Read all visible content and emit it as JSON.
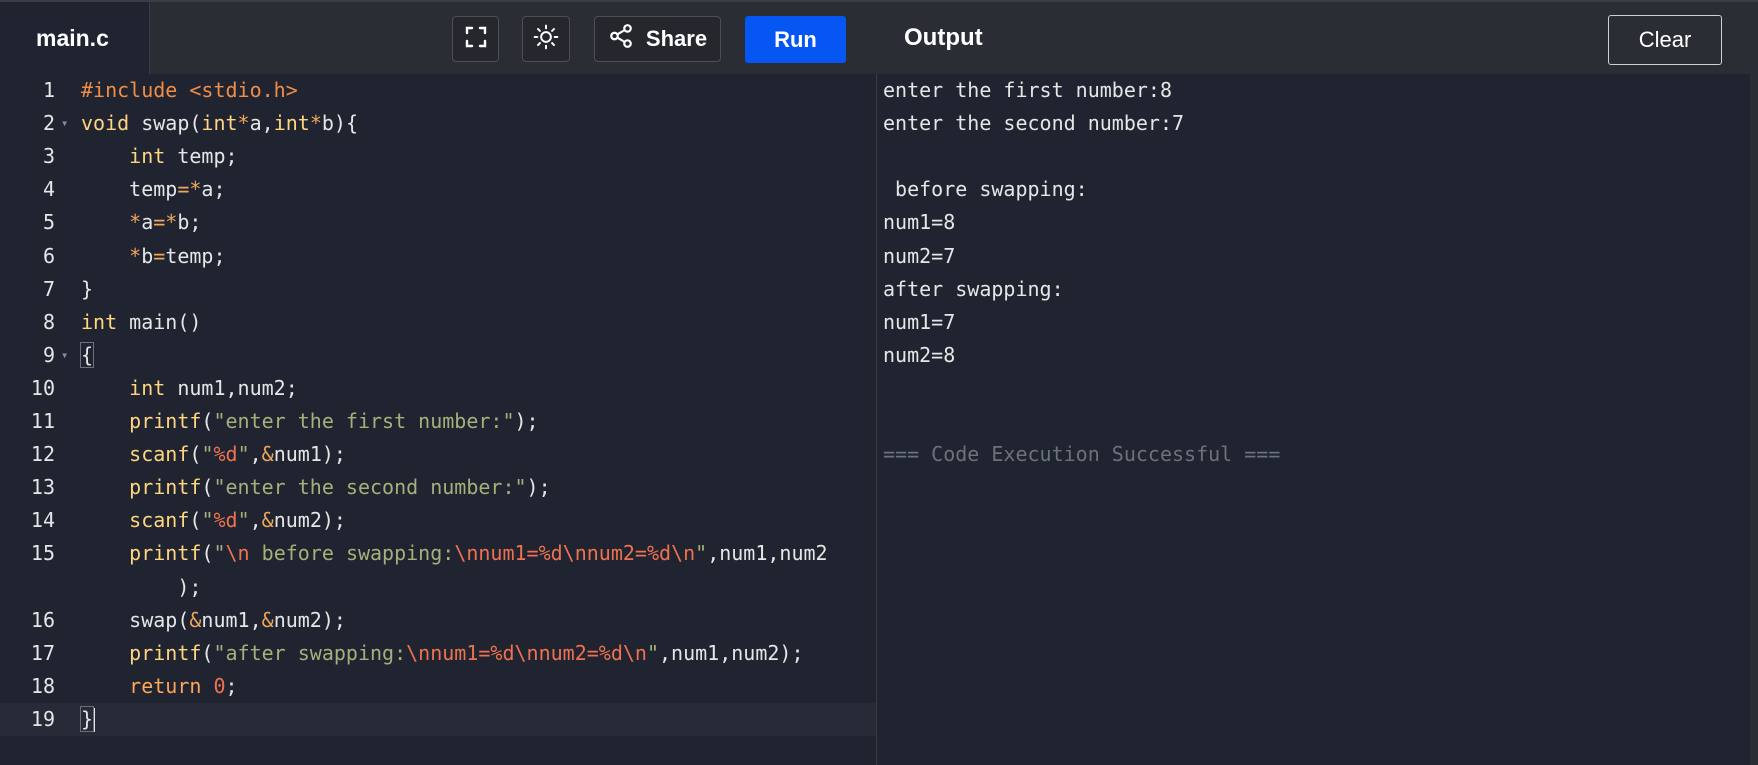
{
  "header": {
    "file_tab": "main.c",
    "share_label": "Share",
    "run_label": "Run",
    "output_title": "Output",
    "clear_label": "Clear"
  },
  "icons": {
    "fullscreen": "fullscreen-icon",
    "theme": "sun-icon",
    "share": "share-icon"
  },
  "colors": {
    "run_button": "#0556f3",
    "background": "#1f2430",
    "toolbar": "#2a2d34"
  },
  "editor": {
    "lines": [
      {
        "num": "1",
        "parts": [
          [
            "pre",
            "#include <stdio.h>"
          ]
        ]
      },
      {
        "num": "2",
        "fold": true,
        "parts": [
          [
            "kw",
            "void"
          ],
          [
            "",
            " swap("
          ],
          [
            "kw",
            "int"
          ],
          [
            "op",
            "*"
          ],
          [
            "",
            "a,"
          ],
          [
            "kw",
            "int"
          ],
          [
            "op",
            "*"
          ],
          [
            "",
            "b){"
          ]
        ]
      },
      {
        "num": "3",
        "parts": [
          [
            "",
            "    "
          ],
          [
            "kw",
            "int"
          ],
          [
            "",
            " temp;"
          ]
        ]
      },
      {
        "num": "4",
        "parts": [
          [
            "",
            "    temp"
          ],
          [
            "op",
            "=*"
          ],
          [
            "",
            "a;"
          ]
        ]
      },
      {
        "num": "5",
        "parts": [
          [
            "",
            "    "
          ],
          [
            "op",
            "*"
          ],
          [
            "",
            "a"
          ],
          [
            "op",
            "=*"
          ],
          [
            "",
            "b;"
          ]
        ]
      },
      {
        "num": "6",
        "parts": [
          [
            "",
            "    "
          ],
          [
            "op",
            "*"
          ],
          [
            "",
            "b"
          ],
          [
            "op",
            "="
          ],
          [
            "",
            "temp;"
          ]
        ]
      },
      {
        "num": "7",
        "parts": [
          [
            "",
            "}"
          ]
        ]
      },
      {
        "num": "8",
        "parts": [
          [
            "kw",
            "int"
          ],
          [
            "",
            " main()"
          ]
        ]
      },
      {
        "num": "9",
        "fold": true,
        "parts": [
          [
            "brace",
            "{"
          ]
        ]
      },
      {
        "num": "10",
        "parts": [
          [
            "",
            "    "
          ],
          [
            "kw",
            "int"
          ],
          [
            "",
            " num1,num2;"
          ]
        ]
      },
      {
        "num": "11",
        "parts": [
          [
            "",
            "    "
          ],
          [
            "kw",
            "printf"
          ],
          [
            "",
            "("
          ],
          [
            "str",
            "\"enter the first number:\""
          ],
          [
            "",
            ");"
          ]
        ]
      },
      {
        "num": "12",
        "parts": [
          [
            "",
            "    "
          ],
          [
            "kw",
            "scanf"
          ],
          [
            "",
            "("
          ],
          [
            "str",
            "\""
          ],
          [
            "esc",
            "%d"
          ],
          [
            "str",
            "\""
          ],
          [
            "",
            ","
          ],
          [
            "op",
            "&"
          ],
          [
            "",
            "num1);"
          ]
        ]
      },
      {
        "num": "13",
        "parts": [
          [
            "",
            "    "
          ],
          [
            "kw",
            "printf"
          ],
          [
            "",
            "("
          ],
          [
            "str",
            "\"enter the second number:\""
          ],
          [
            "",
            ");"
          ]
        ]
      },
      {
        "num": "14",
        "parts": [
          [
            "",
            "    "
          ],
          [
            "kw",
            "scanf"
          ],
          [
            "",
            "("
          ],
          [
            "str",
            "\""
          ],
          [
            "esc",
            "%d"
          ],
          [
            "str",
            "\""
          ],
          [
            "",
            ","
          ],
          [
            "op",
            "&"
          ],
          [
            "",
            "num2);"
          ]
        ]
      },
      {
        "num": "15",
        "parts": [
          [
            "",
            "    "
          ],
          [
            "kw",
            "printf"
          ],
          [
            "",
            "("
          ],
          [
            "str",
            "\""
          ],
          [
            "esc",
            "\\n"
          ],
          [
            "str",
            " before swapping:"
          ],
          [
            "esc",
            "\\nnum1=%d\\nnum2=%d\\n"
          ],
          [
            "str",
            "\""
          ],
          [
            "",
            ",num1,num2"
          ]
        ]
      },
      {
        "num": "",
        "parts": [
          [
            "",
            "        );"
          ]
        ]
      },
      {
        "num": "16",
        "parts": [
          [
            "",
            "    swap("
          ],
          [
            "op",
            "&"
          ],
          [
            "",
            "num1,"
          ],
          [
            "op",
            "&"
          ],
          [
            "",
            "num2);"
          ]
        ]
      },
      {
        "num": "17",
        "parts": [
          [
            "",
            "    "
          ],
          [
            "kw",
            "printf"
          ],
          [
            "",
            "("
          ],
          [
            "str",
            "\"after swapping:"
          ],
          [
            "esc",
            "\\nnum1=%d\\nnum2=%d\\n"
          ],
          [
            "str",
            "\""
          ],
          [
            "",
            ",num1,num2);"
          ]
        ]
      },
      {
        "num": "18",
        "parts": [
          [
            "",
            "    "
          ],
          [
            "ret",
            "return"
          ],
          [
            "",
            " "
          ],
          [
            "num",
            "0"
          ],
          [
            "",
            ";"
          ]
        ]
      },
      {
        "num": "19",
        "active": true,
        "cursor": true,
        "parts": [
          [
            "brace",
            "}"
          ]
        ]
      }
    ]
  },
  "output": {
    "lines": [
      {
        "text": "enter the first number:8"
      },
      {
        "text": "enter the second number:7"
      },
      {
        "text": ""
      },
      {
        "text": " before swapping:"
      },
      {
        "text": "num1=8"
      },
      {
        "text": "num2=7"
      },
      {
        "text": "after swapping:"
      },
      {
        "text": "num1=7"
      },
      {
        "text": "num2=8"
      },
      {
        "text": ""
      },
      {
        "text": ""
      },
      {
        "text": "=== Code Execution Successful ===",
        "muted": true
      }
    ]
  }
}
